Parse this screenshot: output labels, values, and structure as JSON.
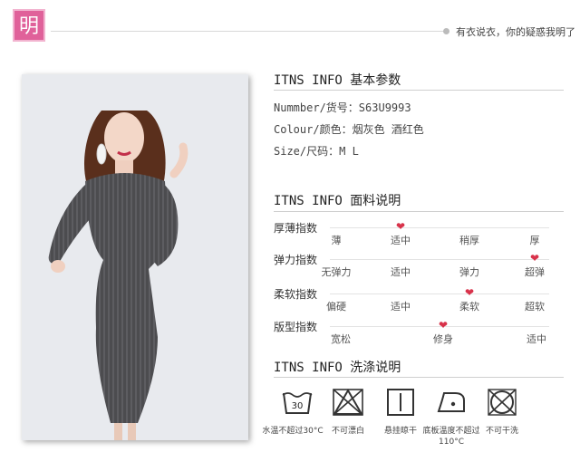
{
  "header": {
    "badge": "明",
    "slogan": "有衣说衣，你的疑惑我明了"
  },
  "basic": {
    "title_en": "ITNS INFO ",
    "title_cn": "基本参数",
    "number_line": "Nummber/货号：S63U9993",
    "colour_line": "Colour/颜色：烟灰色 酒红色",
    "size_line": "Size/尺码：M L"
  },
  "fabric": {
    "title_en": "ITNS INFO ",
    "title_cn": "面料说明",
    "rows": [
      {
        "label": "厚薄指数",
        "scale": [
          "薄",
          "适中",
          "稍厚",
          "厚"
        ],
        "selected": "适中"
      },
      {
        "label": "弹力指数",
        "scale": [
          "无弹力",
          "适中",
          "弹力",
          "超弹"
        ],
        "selected": "超弹"
      },
      {
        "label": "柔软指数",
        "scale": [
          "偏硬",
          "适中",
          "柔软",
          "超软"
        ],
        "selected": "柔软"
      },
      {
        "label": "版型指数",
        "scale": [
          "宽松",
          "修身",
          "适中"
        ],
        "selected": "修身"
      }
    ]
  },
  "washing": {
    "title_en": "ITNS INFO ",
    "title_cn": "洗涤说明",
    "items": [
      {
        "icon": "wash-30-icon",
        "label": "水温不超过30°C",
        "wash_temp": "30"
      },
      {
        "icon": "no-bleach-icon",
        "label": "不可漂白"
      },
      {
        "icon": "hang-dry-icon",
        "label": "悬挂晾干"
      },
      {
        "icon": "iron-low-icon",
        "label": "底板温度不超过110°C"
      },
      {
        "icon": "no-dry-clean-icon",
        "label": "不可干洗"
      }
    ]
  },
  "colors": {
    "accent": "#e0619a",
    "heart": "#d8324a",
    "dress": "#4a4a4c"
  }
}
